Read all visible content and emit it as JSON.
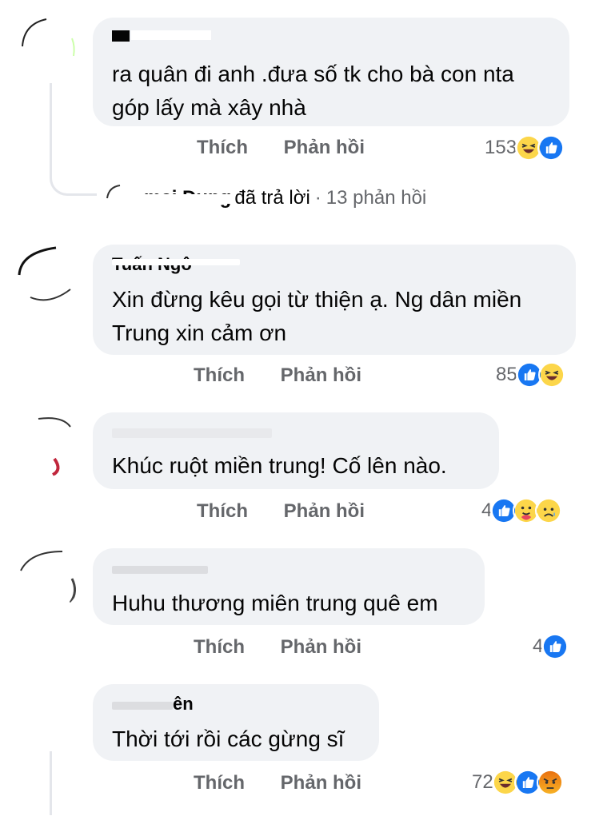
{
  "comments": [
    {
      "name_suffix": "",
      "lines": [
        "ra quân đi anh .đưa số tk cho bà con nta",
        "góp lấy mà xây nhà"
      ],
      "like_label": "Thích",
      "reply_label": "Phản hồi",
      "reaction_count": "153",
      "reactions": [
        "haha-icon",
        "like-icon"
      ]
    },
    {
      "name_suffix": "Tuấn Ngô",
      "lines": [
        "Xin đừng kêu gọi từ thiện ạ. Ng dân miền",
        "Trung xin cảm ơn"
      ],
      "like_label": "Thích",
      "reply_label": "Phản hồi",
      "reaction_count": "85",
      "reactions": [
        "like-icon",
        "haha-icon"
      ]
    },
    {
      "name_suffix": "",
      "lines": [
        "Khúc ruột miền trung! Cố lên nào."
      ],
      "like_label": "Thích",
      "reply_label": "Phản hồi",
      "reaction_count": "4",
      "reactions": [
        "like-icon",
        "care-icon",
        "sad-icon"
      ]
    },
    {
      "name_suffix": "",
      "lines": [
        "Huhu thương miên trung quê em"
      ],
      "like_label": "Thích",
      "reply_label": "Phản hồi",
      "reaction_count": "4",
      "reactions": [
        "like-icon"
      ]
    },
    {
      "name_suffix": "ên",
      "lines": [
        "Thời tới rồi các gừng sĩ"
      ],
      "like_label": "Thích",
      "reply_label": "Phản hồi",
      "reaction_count": "72",
      "reactions": [
        "haha-icon",
        "like-icon",
        "angry-icon"
      ]
    }
  ],
  "reply_summary": {
    "action": "đã trả lời",
    "separator": "·",
    "count": "13 phản hồi"
  },
  "colors": {
    "bubble": "#f0f2f5",
    "secondary_text": "#65676b",
    "like_blue": "#1877f2",
    "haha_yellow": "#fcd64a",
    "angry_red": "#e9710f"
  }
}
